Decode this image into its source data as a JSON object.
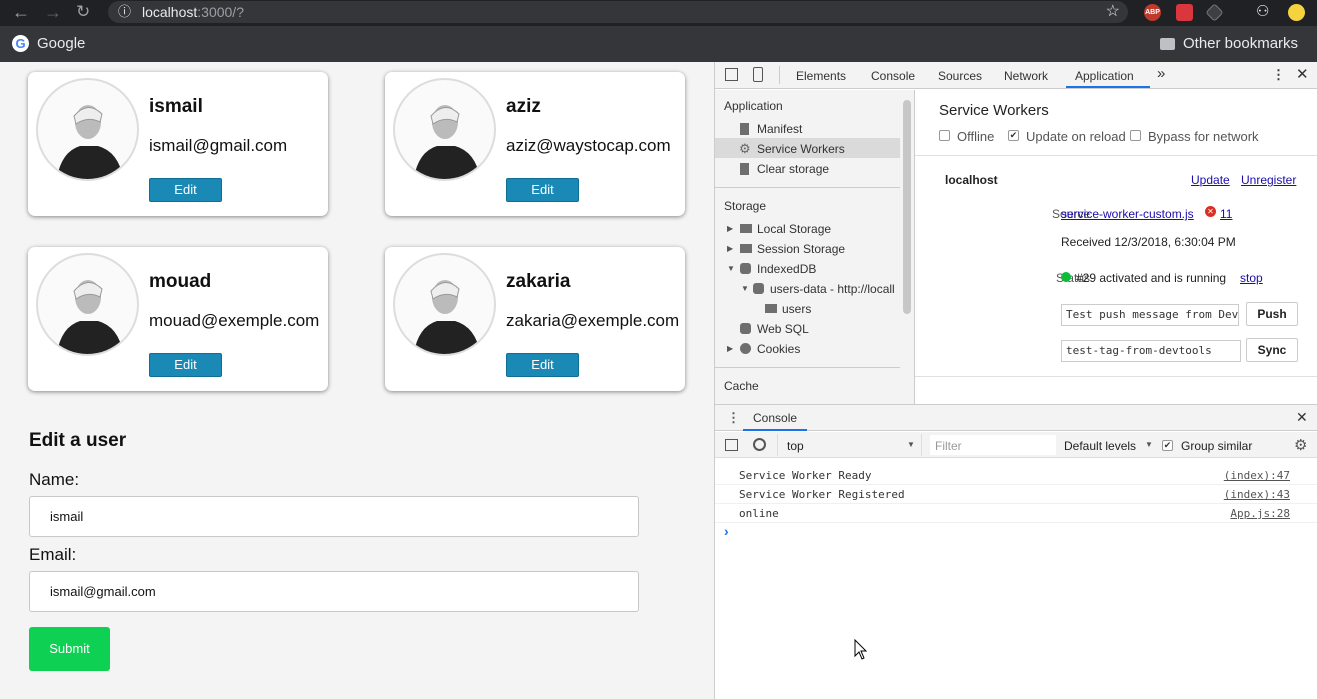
{
  "browser": {
    "url_host": "localhost",
    "url_rest": ":3000/?",
    "bookmark_google": "Google",
    "bookmark_other": "Other bookmarks",
    "abp_label": "ABP"
  },
  "users": [
    {
      "name": "ismail",
      "email": "ismail@gmail.com",
      "edit": "Edit"
    },
    {
      "name": "aziz",
      "email": "aziz@waystocap.com",
      "edit": "Edit"
    },
    {
      "name": "mouad",
      "email": "mouad@exemple.com",
      "edit": "Edit"
    },
    {
      "name": "zakaria",
      "email": "zakaria@exemple.com",
      "edit": "Edit"
    }
  ],
  "form": {
    "title": "Edit a user",
    "name_label": "Name:",
    "name_value": "ismail",
    "email_label": "Email:",
    "email_value": "ismail@gmail.com",
    "submit": "Submit"
  },
  "devtools": {
    "tabs": [
      "Elements",
      "Console",
      "Sources",
      "Network",
      "Application"
    ],
    "more": "»",
    "sidebar": {
      "app_header": "Application",
      "app_items": [
        "Manifest",
        "Service Workers",
        "Clear storage"
      ],
      "storage_header": "Storage",
      "storage_items": [
        "Local Storage",
        "Session Storage",
        "IndexedDB",
        "users-data - http://locall",
        "users",
        "Web SQL",
        "Cookies"
      ],
      "cache_header": "Cache"
    },
    "sw": {
      "title": "Service Workers",
      "offline": "Offline",
      "update_on_reload": "Update on reload",
      "bypass": "Bypass for network",
      "host": "localhost",
      "update": "Update",
      "unregister": "Unregister",
      "source_label": "Source",
      "source_file": "service-worker-custom.js",
      "error_count": "11",
      "received": "Received 12/3/2018, 6:30:04 PM",
      "status_label": "Status",
      "status_text": "#29 activated and is running",
      "stop": "stop",
      "push_label": "Push",
      "push_value": "Test push message from DevTools.",
      "push_btn": "Push",
      "sync_label": "Sync",
      "sync_value": "test-tag-from-devtools",
      "sync_btn": "Sync"
    },
    "console": {
      "tab": "Console",
      "context": "top",
      "filter_placeholder": "Filter",
      "levels": "Default levels",
      "group_similar": "Group similar",
      "messages": [
        {
          "text": "Service Worker Ready",
          "source": "(index):47"
        },
        {
          "text": "Service Worker Registered",
          "source": "(index):43"
        },
        {
          "text": "online",
          "source": "App.js:28"
        }
      ],
      "prompt": "›"
    }
  },
  "colors": {
    "edit_button": "#1a89b5",
    "submit_button": "#0ed153",
    "status_ok": "#0ebb3c",
    "active_tab": "#1a73e8"
  }
}
